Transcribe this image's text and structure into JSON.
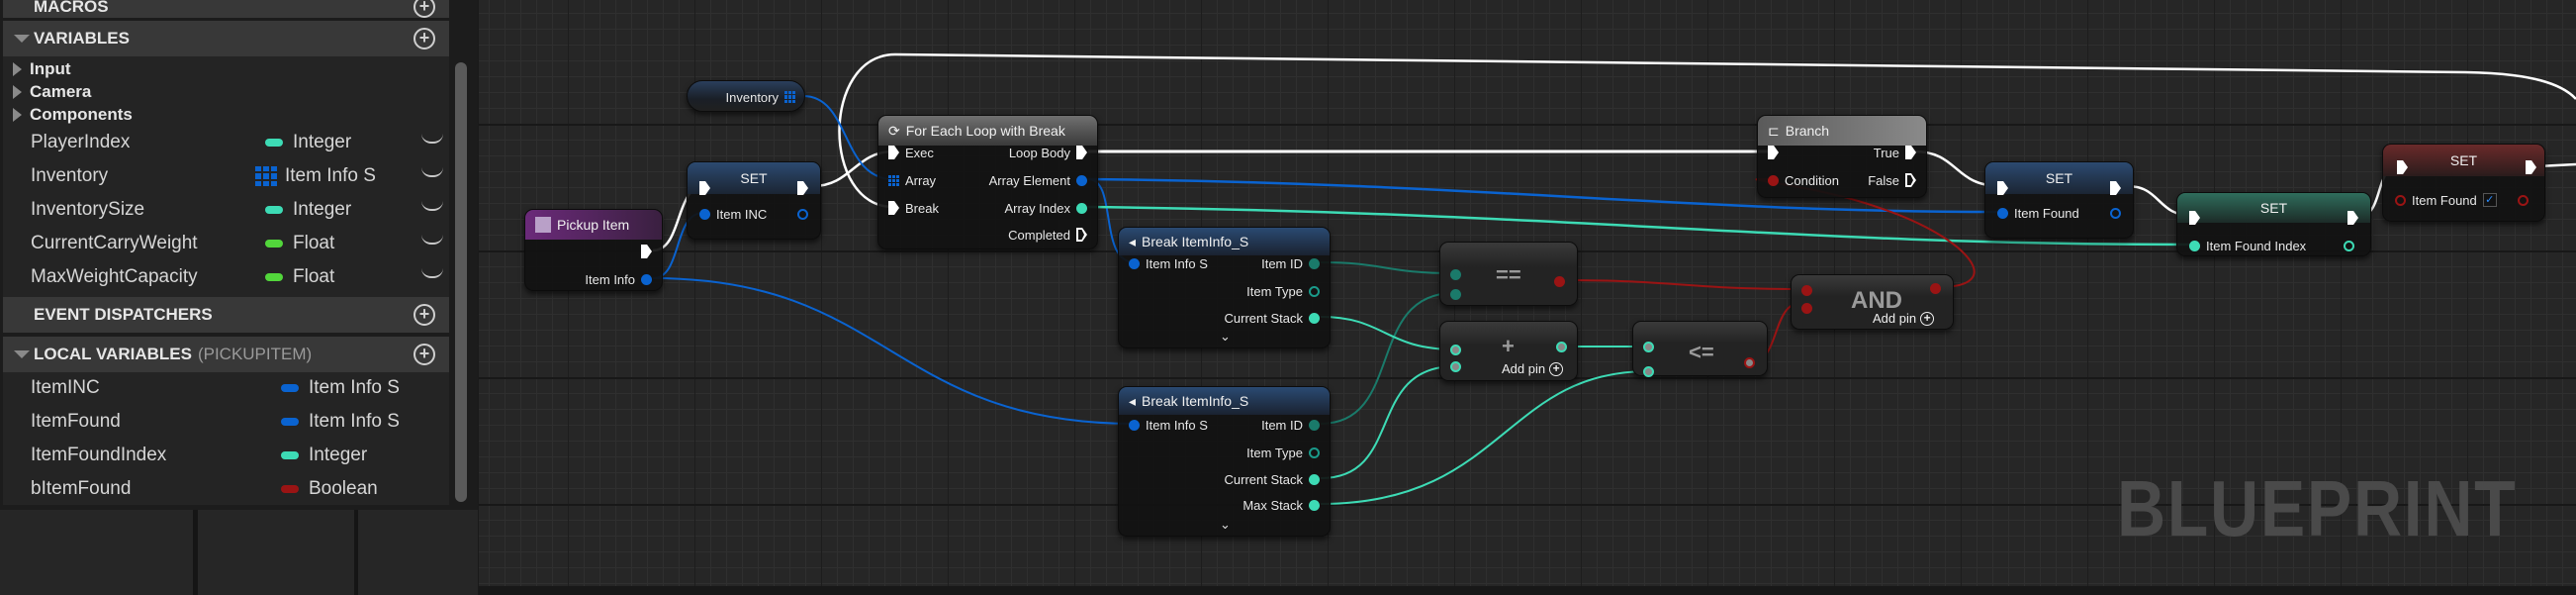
{
  "sidebar": {
    "macros_header": "MACROS",
    "variables_header": "VARIABLES",
    "categories": [
      "Input",
      "Camera",
      "Components"
    ],
    "variables": [
      {
        "name": "PlayerIndex",
        "type": "Integer",
        "color": "#3ddbb5"
      },
      {
        "name": "Inventory",
        "type": "Item Info S",
        "color": "#0a63d0",
        "icon": "array-grid-icon"
      },
      {
        "name": "InventorySize",
        "type": "Integer",
        "color": "#3ddbb5"
      },
      {
        "name": "CurrentCarryWeight",
        "type": "Float",
        "color": "#52d63b"
      },
      {
        "name": "MaxWeightCapacity",
        "type": "Float",
        "color": "#52d63b"
      }
    ],
    "event_dispatchers_header": "EVENT DISPATCHERS",
    "local_variables_header": "LOCAL VARIABLES",
    "local_variables_scope": "(PICKUPITEM)",
    "local_variables": [
      {
        "name": "ItemINC",
        "type": "Item Info S",
        "color": "#0a63d0"
      },
      {
        "name": "ItemFound",
        "type": "Item Info S",
        "color": "#0a63d0"
      },
      {
        "name": "ItemFoundIndex",
        "type": "Integer",
        "color": "#3ddbb5"
      },
      {
        "name": "bItemFound",
        "type": "Boolean",
        "color": "#9a1414"
      }
    ]
  },
  "graph": {
    "inventory_node": {
      "label": "Inventory"
    },
    "pickup_item": {
      "title": "Pickup Item",
      "item_info": "Item Info"
    },
    "set_item_inc": {
      "title": "SET",
      "pin": "Item INC"
    },
    "for_each": {
      "title": "For Each Loop with Break",
      "exec": "Exec",
      "array": "Array",
      "break": "Break",
      "loop_body": "Loop Body",
      "array_element": "Array Element",
      "array_index": "Array Index",
      "completed": "Completed"
    },
    "break1": {
      "title": "Break ItemInfo_S",
      "input": "Item Info S",
      "item_id": "Item ID",
      "item_type": "Item Type",
      "current_stack": "Current Stack"
    },
    "break2": {
      "title": "Break ItemInfo_S",
      "input": "Item Info S",
      "item_id": "Item ID",
      "item_type": "Item Type",
      "current_stack": "Current Stack",
      "max_stack": "Max Stack"
    },
    "equal": {
      "op": "=="
    },
    "add": {
      "op": "+",
      "add_pin": "Add pin"
    },
    "lte": {
      "op": "<="
    },
    "and": {
      "op": "AND",
      "add_pin": "Add pin"
    },
    "branch": {
      "title": "Branch",
      "condition": "Condition",
      "true": "True",
      "false": "False"
    },
    "set_item_found": {
      "title": "SET",
      "pin": "Item Found"
    },
    "set_item_found_index": {
      "title": "SET",
      "pin": "Item Found Index"
    },
    "set_b_item_found": {
      "title": "SET",
      "pin": "Item Found",
      "checked": true,
      "check": "✓"
    }
  },
  "watermark": "BLUEPRINT",
  "colors": {
    "struct": "#0a63d0",
    "integer": "#3ddbb5",
    "float": "#52d63b",
    "boolean": "#9a1414",
    "exec": "#ffffff",
    "name": "#1a7a6a"
  }
}
